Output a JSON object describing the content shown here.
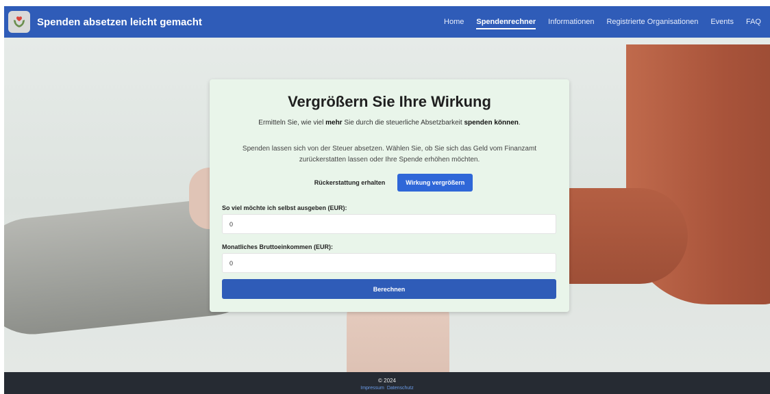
{
  "brand": {
    "logo_icon": "hands-heart-icon",
    "title": "Spenden absetzen leicht gemacht"
  },
  "nav": {
    "items": [
      {
        "label": "Home",
        "active": false
      },
      {
        "label": "Spendenrechner",
        "active": true
      },
      {
        "label": "Informationen",
        "active": false
      },
      {
        "label": "Registrierte Organisationen",
        "active": false
      },
      {
        "label": "Events",
        "active": false
      },
      {
        "label": "FAQ",
        "active": false
      }
    ]
  },
  "card": {
    "title": "Vergrößern Sie Ihre Wirkung",
    "subtitle_pre": "Ermitteln Sie, wie viel ",
    "subtitle_bold1": "mehr",
    "subtitle_mid": " Sie durch die steuerliche Absetzbarkeit ",
    "subtitle_bold2": "spenden können",
    "subtitle_post": ".",
    "description": "Spenden lassen sich von der Steuer absetzen. Wählen Sie, ob Sie sich das Geld vom Finanzamt zurückerstatten lassen oder Ihre Spende erhöhen möchten.",
    "toggle_refund": "Rückerstattung erhalten",
    "toggle_impact": "Wirkung vergrößern",
    "field1_label": "So viel möchte ich selbst ausgeben (EUR):",
    "field1_value": "0",
    "field2_label": "Monatliches Bruttoeinkommen (EUR):",
    "field2_value": "0",
    "submit_label": "Berechnen"
  },
  "footer": {
    "copyright": "© 2024",
    "impressum": "Impressum",
    "datenschutz": "Datenschutz"
  },
  "colors": {
    "navbar": "#2f5cb8",
    "card_bg": "#e9f5ea",
    "primary_button": "#2f67d8",
    "footer_bg": "#262b33"
  }
}
